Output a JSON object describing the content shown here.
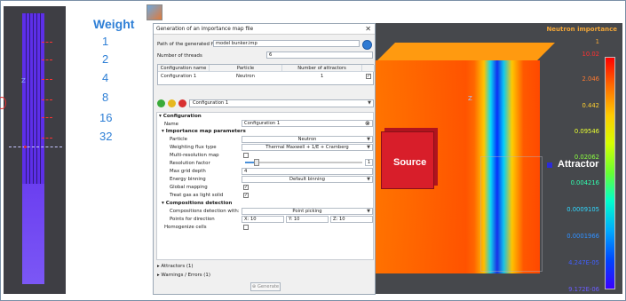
{
  "weights": {
    "title": "Weight",
    "labels": [
      "1",
      "2",
      "4",
      "8",
      "16",
      "32"
    ]
  },
  "left_view": {
    "axis_z": "Z"
  },
  "dialog": {
    "title": "Generation of an importance map file",
    "close_icon": "close-icon",
    "path_label": "Path of the generated file",
    "path_value": "model bunker.imp",
    "threads_label": "Number of threads",
    "threads_value": "6",
    "table": {
      "headers": [
        "Configuration name",
        "Particle",
        "Number of attractors"
      ],
      "rows": [
        {
          "name": "Configuration 1",
          "particle": "Neutron",
          "attractors": "1",
          "checked": true
        }
      ]
    },
    "config_select": "Configuration 1",
    "configuration_section": "Configuration",
    "name_label": "Name",
    "name_value": "Configuration 1",
    "importance_section": "Importance map parameters",
    "particle_label": "Particle",
    "particle_value": "Neutron",
    "flux_label": "Weighting flux type",
    "flux_value": "Thermal Maxwell + 1/E + Cramberg",
    "multires_label": "Multi-resolution map",
    "resolution_label": "Resolution factor",
    "resolution_value": "1",
    "resolution_level": 0.1,
    "maxgrid_label": "Max grid depth",
    "maxgrid_value": "4",
    "energy_label": "Energy binning",
    "energy_value": "Default binning",
    "global_label": "Global mapping",
    "treat_label": "Treat gas as light solid",
    "compositions_section": "Compositions detection",
    "comp_detect_label": "Compositions detection with:",
    "comp_detect_value": "Point picking",
    "points_label": "Points for direction",
    "points": [
      "X: 10",
      "Y: 10",
      "Z: 10"
    ],
    "homogenize_label": "Homogenize cells",
    "attractors_row": "Attractors (1)",
    "warnings_row": "Warnings / Errors (1)",
    "generate_label": "Generate"
  },
  "view3d": {
    "title": "Neutron importance",
    "source_label": "Source",
    "attractor_label": "Attractor",
    "axis_z": "Z",
    "colorbar_values": [
      "1",
      "10.02",
      "2.046",
      "0.442",
      "0.09546",
      "0.02062",
      "0.004216",
      "0.0009105",
      "0.0001966",
      "4.247E-05",
      "9.172E-06"
    ],
    "colorbar_colors": [
      "#f2a638",
      "#ff3030",
      "#ff7a30",
      "#ffd030",
      "#e8ff30",
      "#8aff40",
      "#30ffb0",
      "#30d8ff",
      "#3090ff",
      "#4060ff",
      "#6a5cff"
    ]
  },
  "colors": {
    "weight_blue": "#2e7fd6",
    "purple": "#5d2fe8",
    "source_red": "#d81e2a"
  }
}
